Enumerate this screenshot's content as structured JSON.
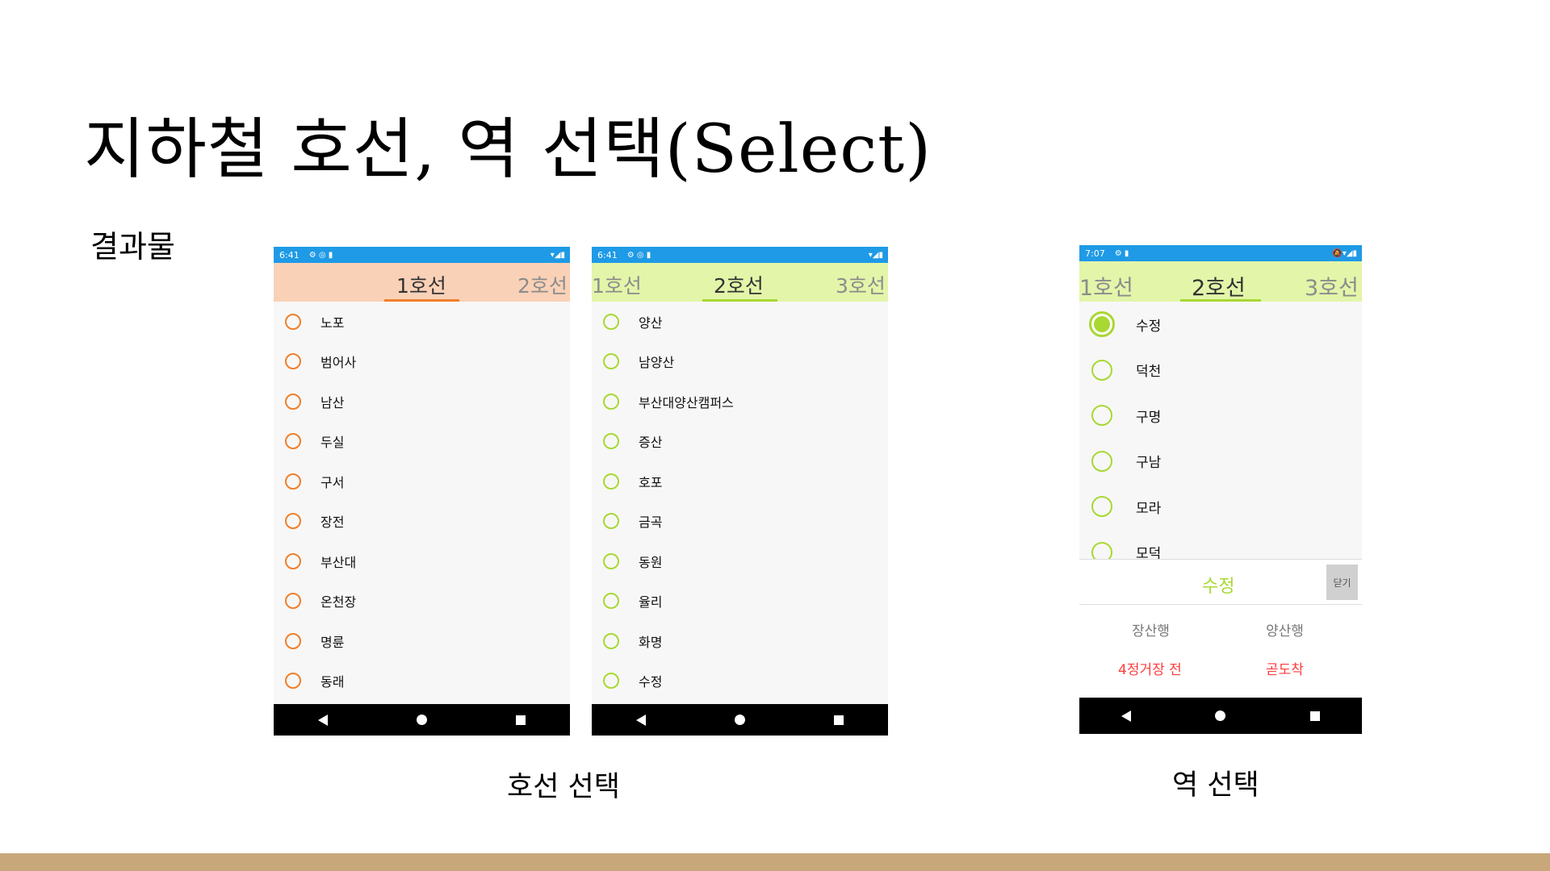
{
  "slide": {
    "title": "지하철 호선, 역 선택(Select)",
    "result_label": "결과물",
    "caption_line_select": "호선 선택",
    "caption_station_select": "역 선택",
    "bottom_band_color": "#c8a77a"
  },
  "phone1": {
    "status_time": "6:41",
    "status_left_icons": "⚙ ◎ ▮",
    "status_right_icons": "▾◢▮",
    "header_color": "#f9d1b7",
    "accent_color": "#f07f2a",
    "tabs": [
      {
        "label": "1호선",
        "active": true
      },
      {
        "label": "2호선",
        "active": false
      }
    ],
    "stations": [
      "노포",
      "범어사",
      "남산",
      "두실",
      "구서",
      "장전",
      "부산대",
      "온천장",
      "명륜",
      "동래"
    ]
  },
  "phone2": {
    "status_time": "6:41",
    "status_left_icons": "⚙ ◎ ▮",
    "status_right_icons": "▾◢▮",
    "header_color": "#e3f5a9",
    "accent_color": "#a8d832",
    "tabs": [
      {
        "label": "1호선",
        "active": false
      },
      {
        "label": "2호선",
        "active": true
      },
      {
        "label": "3호선",
        "active": false
      }
    ],
    "stations": [
      "양산",
      "남양산",
      "부산대양산캠퍼스",
      "증산",
      "호포",
      "금곡",
      "동원",
      "율리",
      "화명",
      "수정"
    ]
  },
  "phone3": {
    "status_time": "7:07",
    "status_left_icons": "⚙ ▮",
    "status_right_icons": "🔕▾◢▮",
    "header_color": "#e3f5a9",
    "accent_color": "#a8d832",
    "tabs": [
      {
        "label": "1호선",
        "active": false
      },
      {
        "label": "2호선",
        "active": true
      },
      {
        "label": "3호선",
        "active": false
      }
    ],
    "stations": [
      "수정",
      "덕천",
      "구명",
      "구남",
      "모라",
      "모덕"
    ],
    "selected_station": "수정",
    "panel": {
      "station_name": "수정",
      "close_label": "닫기",
      "dir1_label": "장산행",
      "dir2_label": "양산행",
      "dir1_status": "4정거장 전",
      "dir2_status": "곧도착",
      "status_color": "#ff3b3b"
    }
  }
}
